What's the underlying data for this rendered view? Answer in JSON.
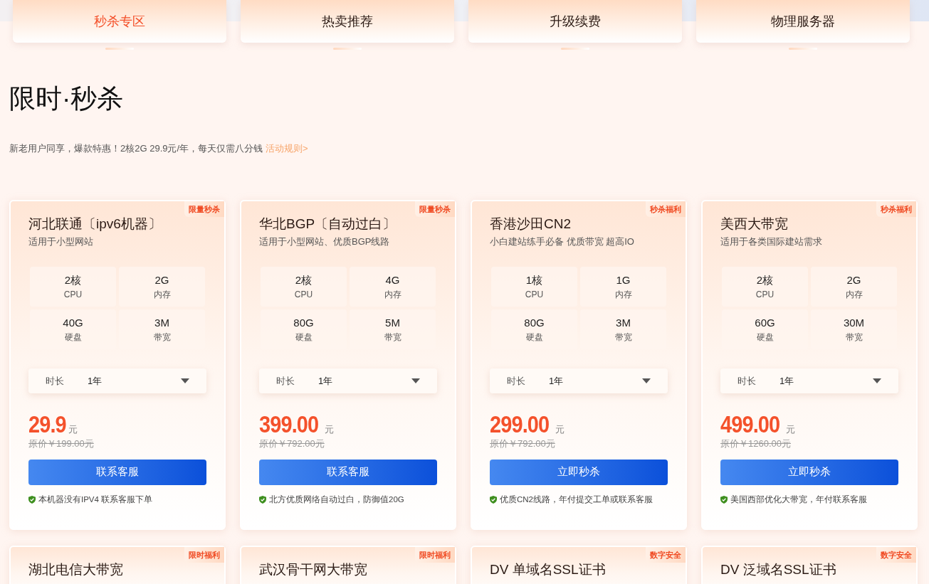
{
  "tabs": [
    {
      "label": "秒杀专区",
      "selected": true
    },
    {
      "label": "热卖推荐",
      "selected": false
    },
    {
      "label": "升级续费",
      "selected": false
    },
    {
      "label": "物理服务器",
      "selected": false
    }
  ],
  "section": {
    "title": "限时·秒杀",
    "intro": "新老用户同享，爆款特惠！2核2G 29.9元/年，每天仅需八分钱",
    "rules_link": "活动规则>"
  },
  "products": [
    {
      "badge": "限量秒杀",
      "name": "河北联通〔ipv6机器〕",
      "subtitle": "适用于小型网站",
      "specs": [
        {
          "value": "2核",
          "label": "CPU"
        },
        {
          "value": "2G",
          "label": "内存"
        },
        {
          "value": "40G",
          "label": "硬盘"
        },
        {
          "value": "3M",
          "label": "带宽"
        }
      ],
      "duration_label": "时长",
      "duration": "1年",
      "price": "29.9",
      "unit": "元",
      "original_price": "原价￥199.00元",
      "button": "联系客服",
      "note": "本机器没有IPV4 联系客服下单"
    },
    {
      "badge": "限量秒杀",
      "name": "华北BGP〔自动过白〕",
      "subtitle": "适用于小型网站、优质BGP线路",
      "specs": [
        {
          "value": "2核",
          "label": "CPU"
        },
        {
          "value": "4G",
          "label": "内存"
        },
        {
          "value": "80G",
          "label": "硬盘"
        },
        {
          "value": "5M",
          "label": "带宽"
        }
      ],
      "duration_label": "时长",
      "duration": "1年",
      "price": "399.00",
      "unit": "元",
      "original_price": "原价￥792.00元",
      "button": "联系客服",
      "note": "北方优质网络自动过白，防御值20G"
    },
    {
      "badge": "秒杀福利",
      "name": "香港沙田CN2",
      "subtitle": "小白建站练手必备 优质带宽 超高IO",
      "specs": [
        {
          "value": "1核",
          "label": "CPU"
        },
        {
          "value": "1G",
          "label": "内存"
        },
        {
          "value": "80G",
          "label": "硬盘"
        },
        {
          "value": "3M",
          "label": "带宽"
        }
      ],
      "duration_label": "时长",
      "duration": "1年",
      "price": "299.00",
      "unit": "元",
      "original_price": "原价￥792.00元",
      "button": "立即秒杀",
      "note": "优质CN2线路，年付提交工单或联系客服"
    },
    {
      "badge": "秒杀福利",
      "name": "美西大带宽",
      "subtitle": "适用于各类国际建站需求",
      "specs": [
        {
          "value": "2核",
          "label": "CPU"
        },
        {
          "value": "2G",
          "label": "内存"
        },
        {
          "value": "60G",
          "label": "硬盘"
        },
        {
          "value": "30M",
          "label": "带宽"
        }
      ],
      "duration_label": "时长",
      "duration": "1年",
      "price": "499.00",
      "unit": "元",
      "original_price": "原价￥1260.00元",
      "button": "立即秒杀",
      "note": "美国西部优化大带宽，年付联系客服"
    },
    {
      "badge": "限时福利",
      "name": "湖北电信大带宽"
    },
    {
      "badge": "限时福利",
      "name": "武汉骨干网大带宽"
    },
    {
      "badge": "数字安全",
      "name": "DV 单域名SSL证书"
    },
    {
      "badge": "数字安全",
      "name": "DV 泛域名SSL证书"
    }
  ]
}
